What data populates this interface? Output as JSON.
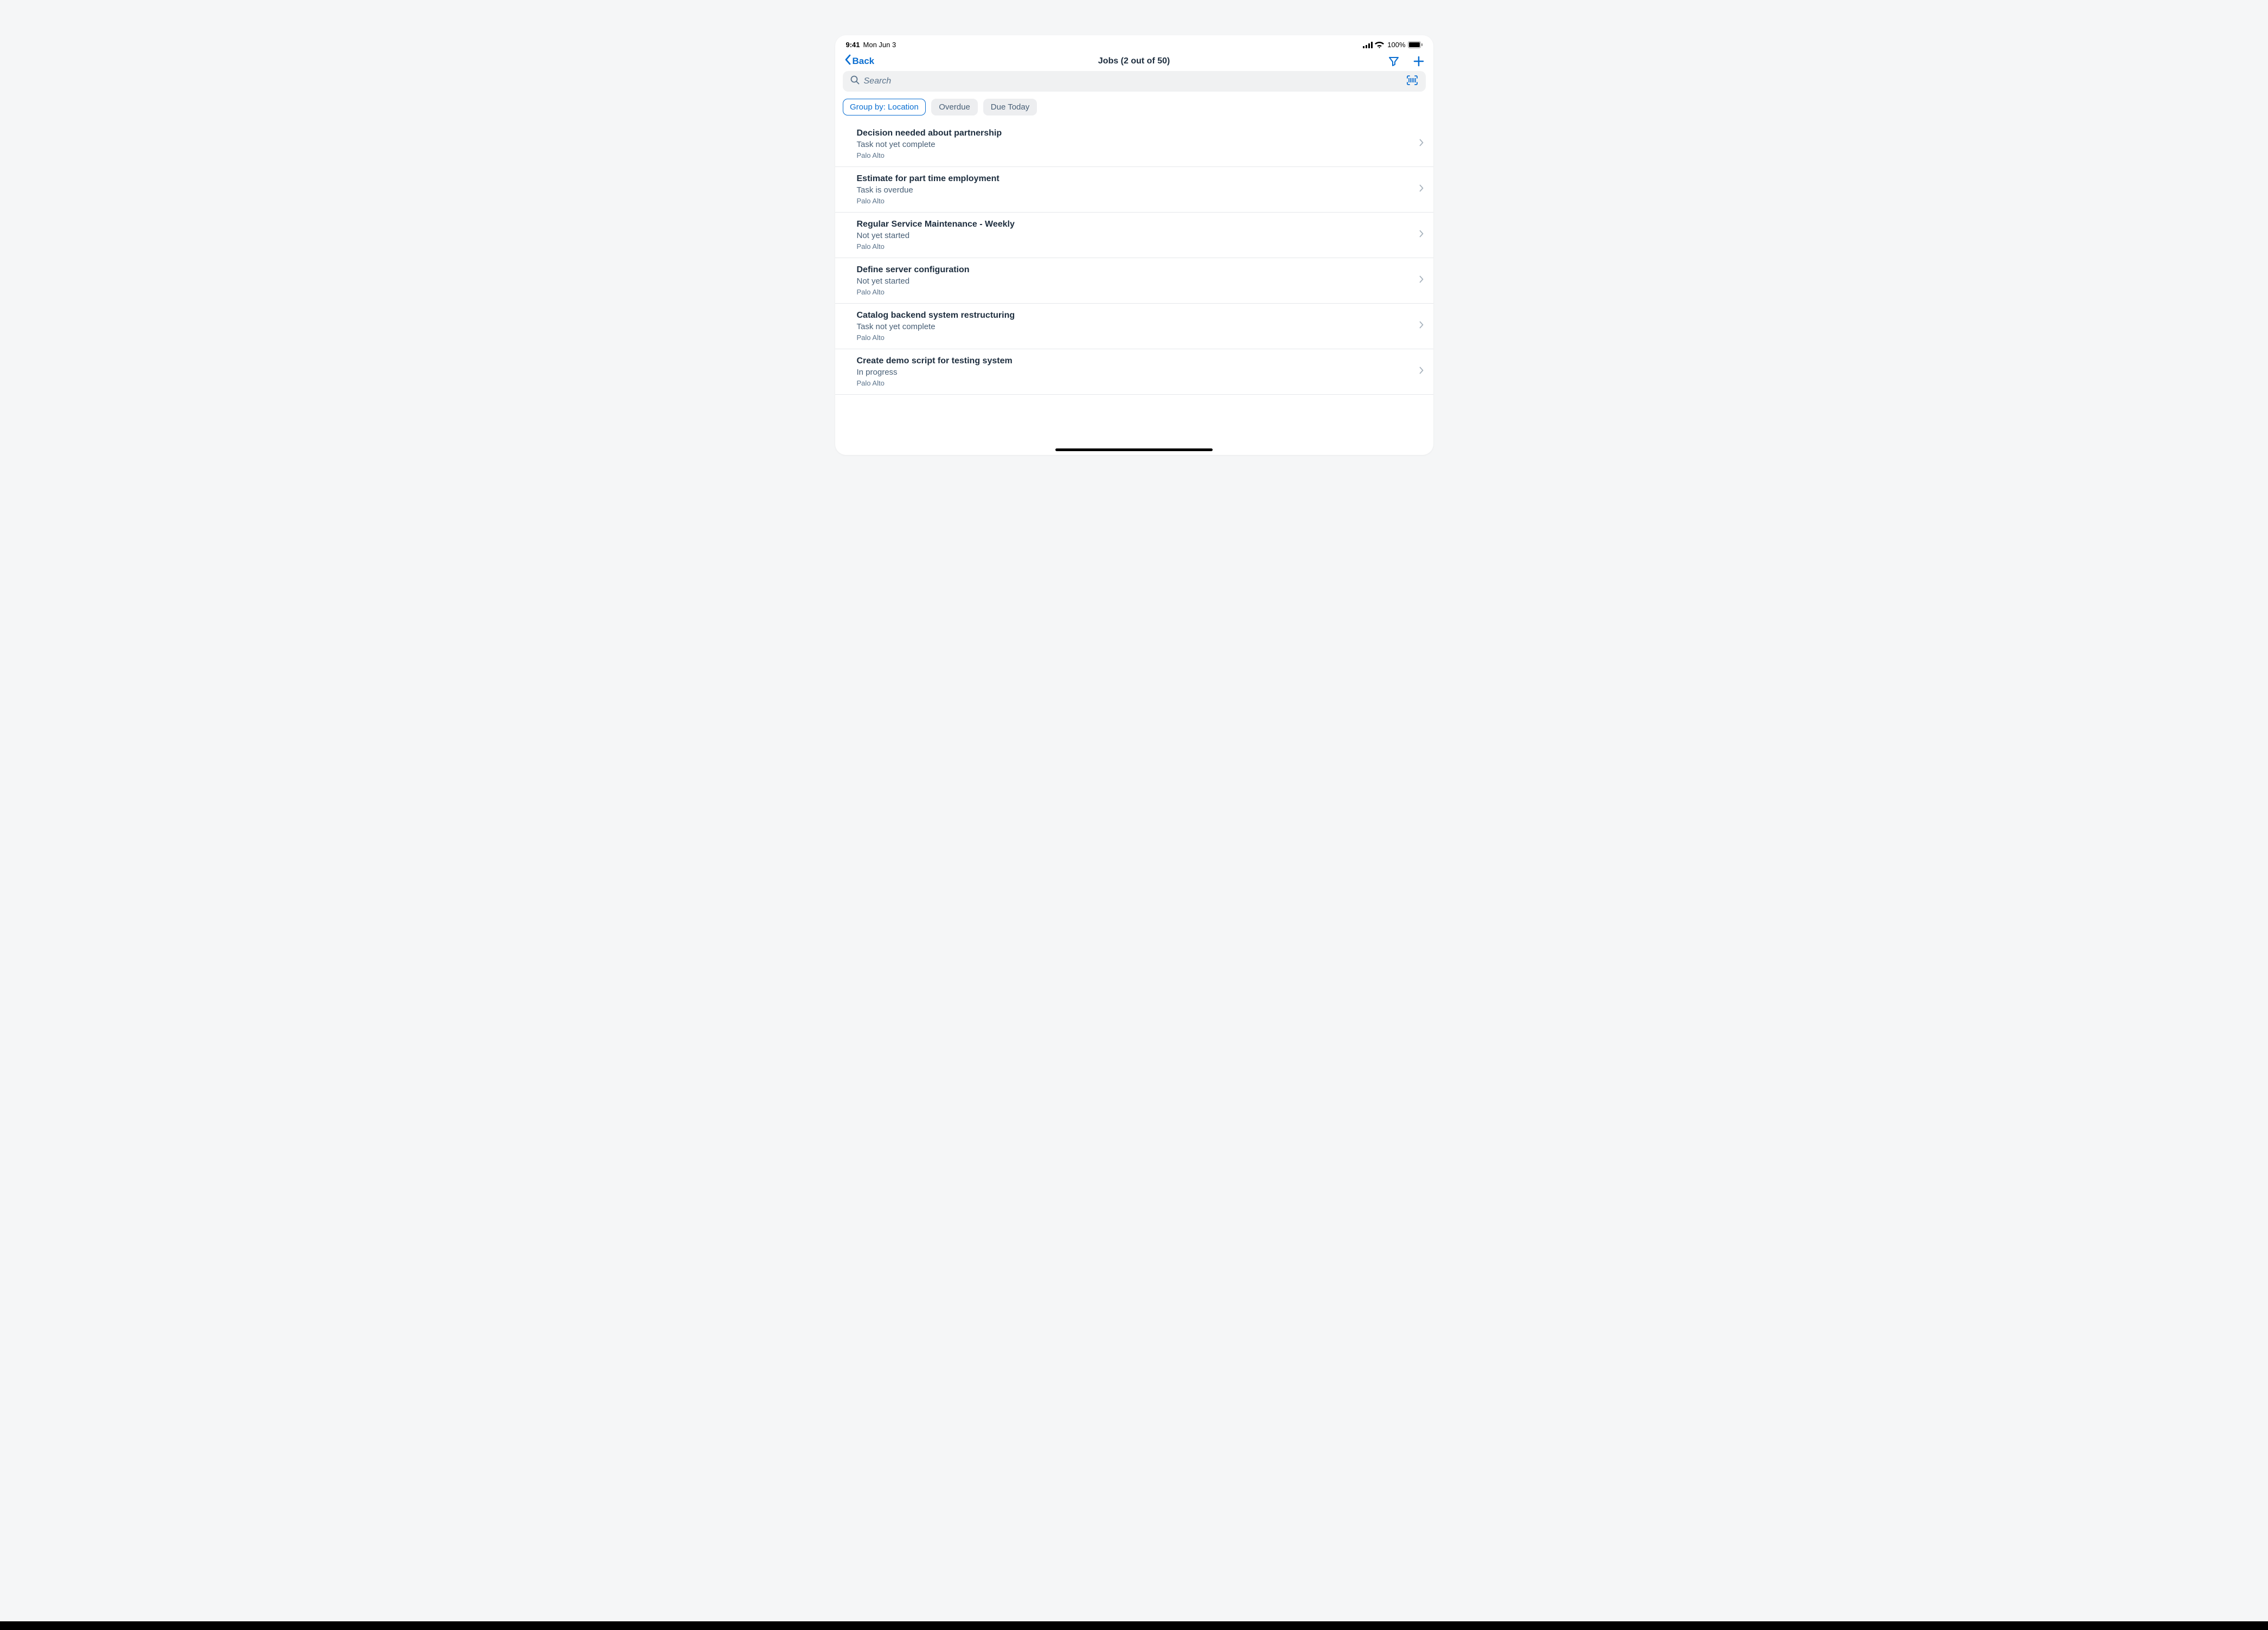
{
  "statusBar": {
    "time": "9:41",
    "date": "Mon Jun 3",
    "battery": "100%"
  },
  "nav": {
    "backLabel": "Back",
    "title": "Jobs (2 out of 50)"
  },
  "search": {
    "placeholder": "Search"
  },
  "chips": [
    {
      "label": "Group by: Location",
      "active": true
    },
    {
      "label": "Overdue",
      "active": false
    },
    {
      "label": "Due Today",
      "active": false
    }
  ],
  "jobs": [
    {
      "title": "Decision needed about partnership",
      "status": "Task not yet complete",
      "location": "Palo Alto"
    },
    {
      "title": "Estimate for part time employment",
      "status": "Task is overdue",
      "location": "Palo Alto"
    },
    {
      "title": "Regular Service Maintenance - Weekly",
      "status": "Not yet started",
      "location": "Palo Alto"
    },
    {
      "title": "Define server configuration",
      "status": "Not yet started",
      "location": "Palo Alto"
    },
    {
      "title": "Catalog backend system restructuring",
      "status": "Task not yet complete",
      "location": "Palo Alto"
    },
    {
      "title": "Create demo script for testing system",
      "status": "In progress",
      "location": "Palo Alto"
    }
  ]
}
